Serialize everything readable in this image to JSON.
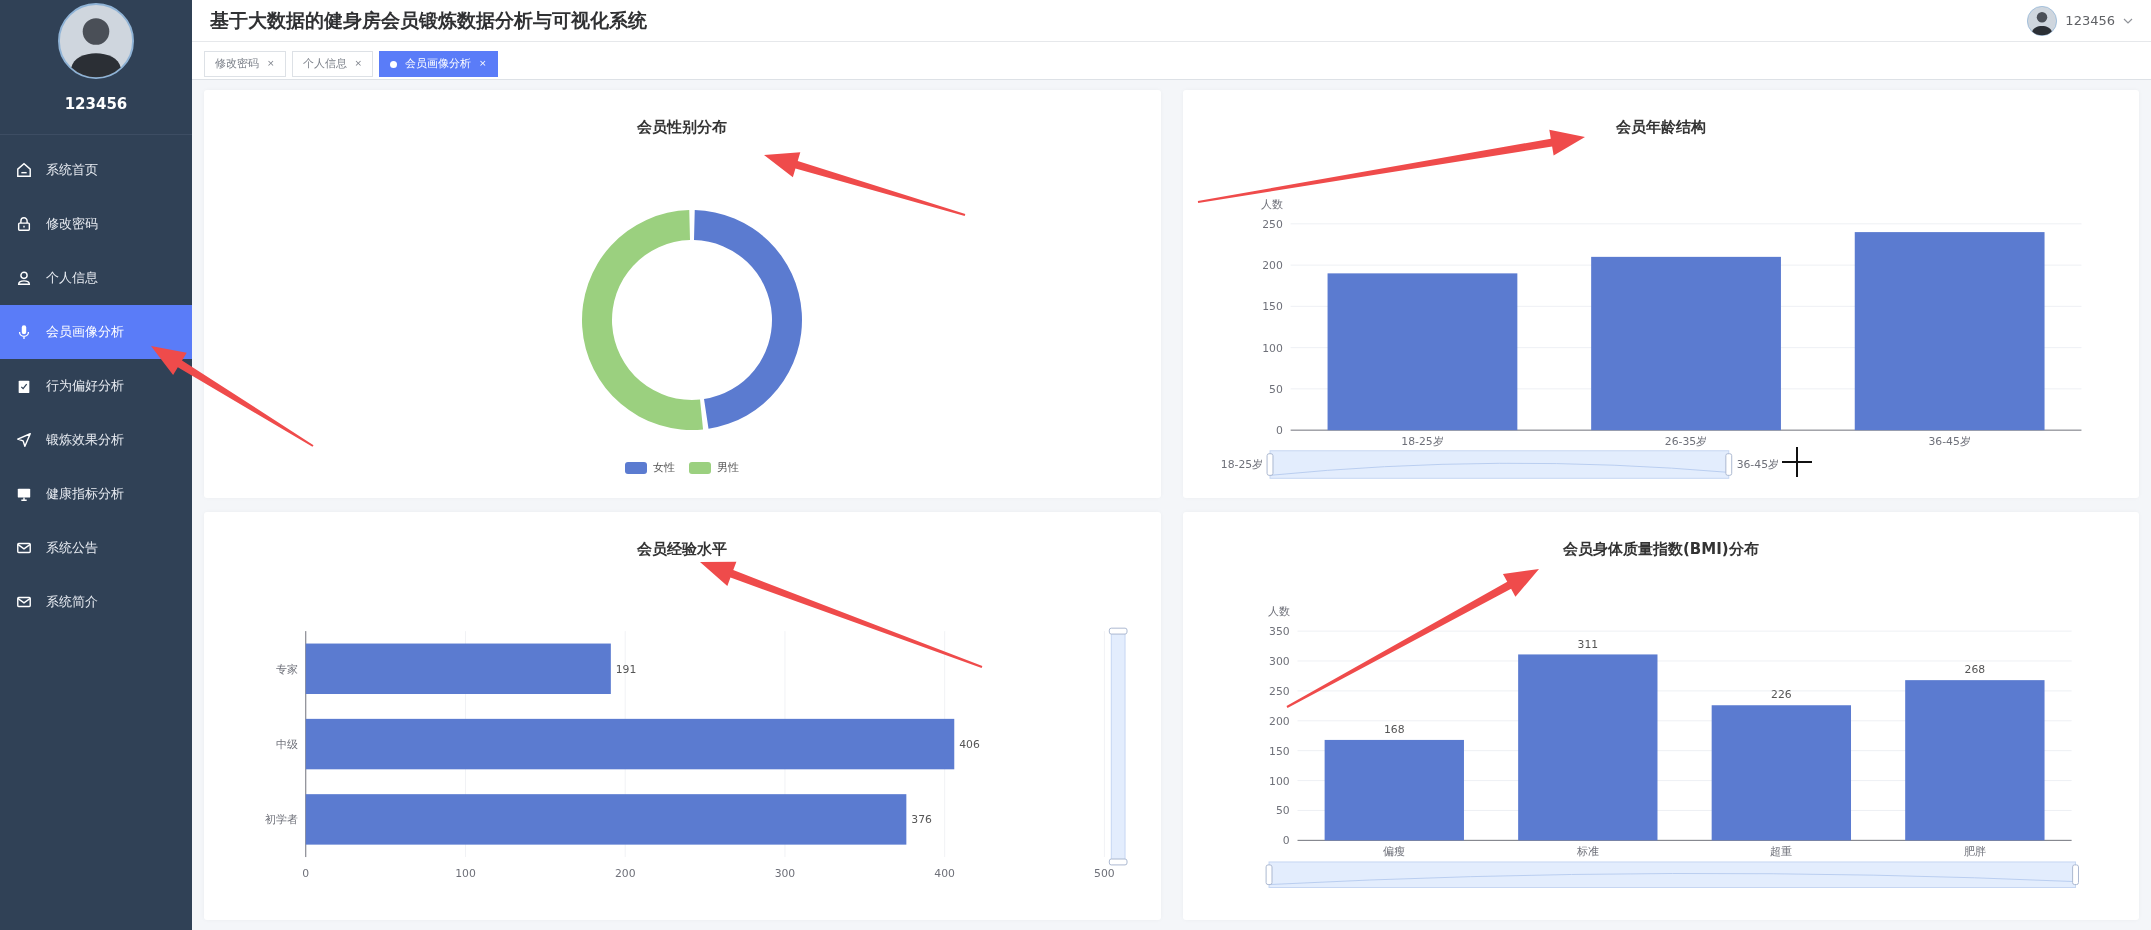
{
  "header": {
    "title": "基于大数据的健身房会员锻炼数据分析与可视化系统",
    "user": "123456"
  },
  "sidebar": {
    "user": "123456",
    "items": [
      {
        "label": "系统首页",
        "selected": false
      },
      {
        "label": "修改密码",
        "selected": false
      },
      {
        "label": "个人信息",
        "selected": false
      },
      {
        "label": "会员画像分析",
        "selected": true
      },
      {
        "label": "行为偏好分析",
        "selected": false
      },
      {
        "label": "锻炼效果分析",
        "selected": false
      },
      {
        "label": "健康指标分析",
        "selected": false
      },
      {
        "label": "系统公告",
        "selected": false
      },
      {
        "label": "系统简介",
        "selected": false
      }
    ]
  },
  "tabs": [
    {
      "label": "修改密码",
      "close": "×",
      "selected": false
    },
    {
      "label": "个人信息",
      "close": "×",
      "selected": false
    },
    {
      "label": "会员画像分析",
      "close": "×",
      "selected": true
    }
  ],
  "panels": [
    {
      "title": "会员性别分布",
      "kind": "donut",
      "legend": [
        {
          "label": "女性",
          "color": "#5b7bd0"
        },
        {
          "label": "男性",
          "color": "#9bd07f"
        }
      ]
    },
    {
      "title": "会员年龄结构",
      "kind": "bar",
      "zoom_labels": [
        "18-25岁",
        "36-45岁"
      ],
      "chart_data": {
        "type": "bar",
        "ylabel": "人数",
        "categories": [
          "18-25岁",
          "26-35岁",
          "36-45岁"
        ],
        "values": [
          190,
          210,
          240
        ],
        "grid": true,
        "ylim": [
          0,
          250
        ],
        "yticks": [
          0,
          50,
          100,
          150,
          200,
          250
        ]
      }
    },
    {
      "title": "会员经验水平",
      "kind": "hbar",
      "chart_data": {
        "type": "bar",
        "orientation": "horizontal",
        "categories": [
          "专家",
          "中级",
          "初学者"
        ],
        "values": [
          191,
          406,
          376
        ],
        "grid": true,
        "xlim": [
          0,
          500
        ],
        "xticks": [
          0,
          100,
          200,
          300,
          400,
          500
        ],
        "data_labels": true
      }
    },
    {
      "title": "会员身体质量指数(BMI)分布",
      "kind": "bar",
      "chart_data": {
        "type": "bar",
        "ylabel": "人数",
        "categories": [
          "偏瘦",
          "标准",
          "超重",
          "肥胖"
        ],
        "values": [
          168,
          311,
          226,
          268
        ],
        "grid": true,
        "ylim": [
          0,
          350
        ],
        "yticks": [
          0,
          50,
          100,
          150,
          200,
          250,
          300,
          350
        ],
        "data_labels": true
      }
    }
  ]
}
